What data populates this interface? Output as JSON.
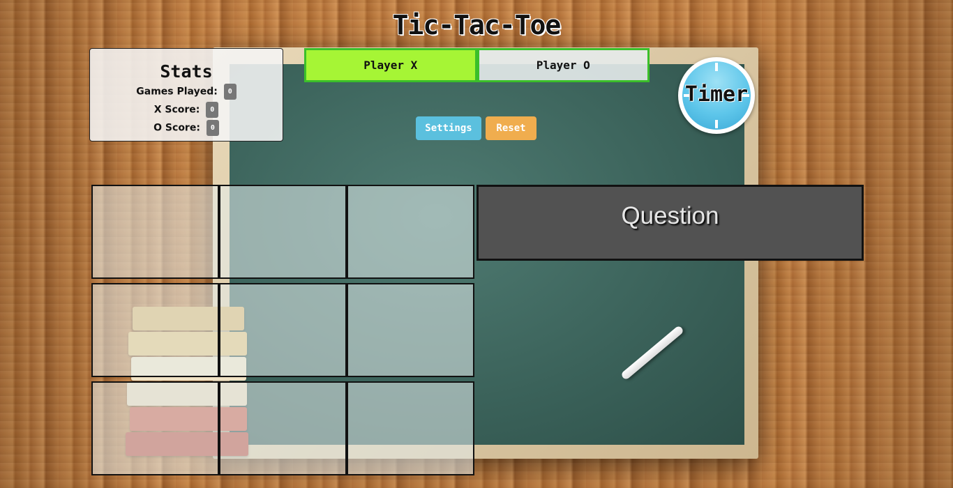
{
  "title": "Tic-Tac-Toe",
  "stats": {
    "heading": "Stats",
    "games_played_label": "Games Played:",
    "games_played": "0",
    "x_score_label": "X Score:",
    "x_score": "0",
    "o_score_label": "O Score:",
    "o_score": "0"
  },
  "players": {
    "x_label": "Player X",
    "o_label": "Player O",
    "active": "X"
  },
  "buttons": {
    "settings": "Settings",
    "reset": "Reset"
  },
  "timer": {
    "label": "Timer"
  },
  "board": {
    "cells": [
      "",
      "",
      "",
      "",
      "",
      "",
      "",
      "",
      ""
    ]
  },
  "question": {
    "text": "Question"
  },
  "colors": {
    "active_player": "#a6f535",
    "player_border": "#3bbf2a",
    "settings_button": "#5bc0de",
    "reset_button": "#f0ad4e",
    "question_bg": "#525252"
  }
}
